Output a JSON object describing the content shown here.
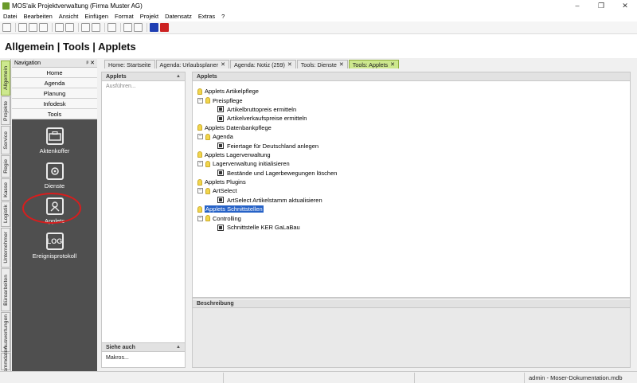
{
  "window": {
    "title": "MOS'aik Projektverwaltung (Firma Muster AG)",
    "controls": [
      "–",
      "❐",
      "✕"
    ]
  },
  "menu": [
    "Datei",
    "Bearbeiten",
    "Ansicht",
    "Einfügen",
    "Format",
    "Projekt",
    "Datensatz",
    "Extras",
    "?"
  ],
  "page_title": "Allgemein | Tools | Applets",
  "left_tabs": [
    "Allgemein",
    "Projekte",
    "Service",
    "Regie",
    "Kasse",
    "Logistik",
    "Unternehmer",
    "Büroarbeiten",
    "Auswertungen",
    "Stammdaten"
  ],
  "navigation": {
    "title": "Navigation",
    "controls": "ᵖ ✕",
    "buttons": [
      "Home",
      "Agenda",
      "Planung",
      "Infodesk",
      "Tools"
    ],
    "items": [
      {
        "label": "Aktenkoffer",
        "icon": "briefcase-icon"
      },
      {
        "label": "Dienste",
        "icon": "services-icon"
      },
      {
        "label": "Applets",
        "icon": "applets-icon"
      },
      {
        "label": "Ereignisprotokoll",
        "icon": "log-icon",
        "glyph": "LOG"
      }
    ]
  },
  "tabs": [
    {
      "label": "Home: Startseite",
      "closable": false,
      "active": false
    },
    {
      "label": "Agenda: Urlaubsplaner",
      "closable": true,
      "active": false
    },
    {
      "label": "Agenda: Notiz (259)",
      "closable": true,
      "active": false
    },
    {
      "label": "Tools: Dienste",
      "closable": true,
      "active": false
    },
    {
      "label": "Tools: Applets",
      "closable": true,
      "active": true
    }
  ],
  "context_panel": {
    "title": "Applets",
    "action": "Ausführen...",
    "see_also_title": "Siehe auch",
    "see_also_item": "Makros..."
  },
  "main": {
    "title": "Applets",
    "tree": [
      {
        "label": "Applets Artikelpflege",
        "level": 0,
        "type": "folder"
      },
      {
        "label": "Preispflege",
        "level": 1,
        "type": "folder"
      },
      {
        "label": "Artikelbruttopreis ermitteln",
        "level": 2,
        "type": "applet"
      },
      {
        "label": "Artikelverkaufspreise ermitteln",
        "level": 2,
        "type": "applet"
      },
      {
        "label": "Applets Datenbankpflege",
        "level": 0,
        "type": "folder"
      },
      {
        "label": "Agenda",
        "level": 1,
        "type": "folder"
      },
      {
        "label": "Feiertage für Deutschland anlegen",
        "level": 2,
        "type": "applet"
      },
      {
        "label": "Applets Lagerverwaltung",
        "level": 0,
        "type": "folder"
      },
      {
        "label": "Lagerverwaltung initialisieren",
        "level": 1,
        "type": "folder"
      },
      {
        "label": "Bestände und Lagerbewegungen löschen",
        "level": 2,
        "type": "applet"
      },
      {
        "label": "Applets Plugins",
        "level": 0,
        "type": "folder"
      },
      {
        "label": "ArtSelect",
        "level": 1,
        "type": "folder"
      },
      {
        "label": "ArtSelect Artikelstamm aktualisieren",
        "level": 2,
        "type": "applet"
      },
      {
        "label": "Applets Schnittstellen",
        "level": 0,
        "type": "folder",
        "selected": true
      },
      {
        "label": "Controlling",
        "level": 1,
        "type": "folder"
      },
      {
        "label": "Schnittstelle KER GaLaBau",
        "level": 2,
        "type": "applet"
      }
    ],
    "description_title": "Beschreibung"
  },
  "status": {
    "user_db": "admin - Moser-Dokumentation.mdb"
  },
  "colors": {
    "accent_tab": "#cde88e",
    "selection": "#2662c7",
    "nav_bg": "#4f4f4f",
    "highlight_oval": "#d81d1d"
  }
}
